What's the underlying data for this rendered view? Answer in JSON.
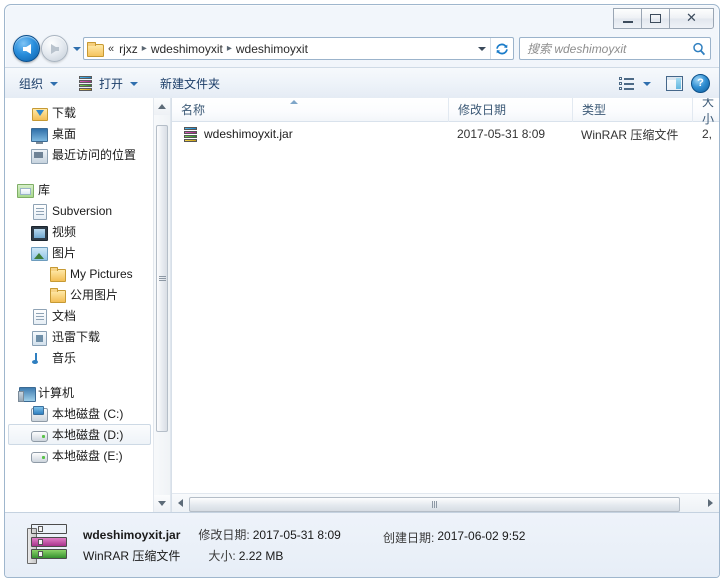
{
  "window": {
    "controls": {
      "minimize": "minimize-button",
      "maximize": "maximize-button",
      "close": "close-button",
      "close_glyph": "✕"
    }
  },
  "address_bar": {
    "overflow_indicator": "«",
    "crumbs": [
      "rjxz",
      "wdeshimoyxit",
      "wdeshimoyxit"
    ],
    "separator": "▸",
    "dropdown_icon": "chevron-down-icon",
    "refresh_icon": "refresh-icon",
    "refresh_glyph": "↻"
  },
  "search": {
    "placeholder": "搜索 wdeshimoyxit",
    "icon": "search-icon"
  },
  "toolbar": {
    "organize_label": "组织",
    "open_label": "打开",
    "new_folder_label": "新建文件夹",
    "view_icon": "list-view-icon",
    "preview_pane_icon": "preview-pane-icon",
    "help_icon": "help-icon",
    "help_glyph": "?"
  },
  "sidebar": {
    "groups": [
      {
        "items": [
          {
            "label": "下载",
            "icon": "downloads-folder-icon",
            "indent": 0,
            "selected": false
          },
          {
            "label": "桌面",
            "icon": "desktop-icon",
            "indent": 0,
            "selected": false
          },
          {
            "label": "最近访问的位置",
            "icon": "recent-places-icon",
            "indent": 0,
            "selected": false
          }
        ]
      },
      {
        "items": [
          {
            "label": "库",
            "icon": "libraries-icon",
            "indent": -1,
            "selected": false
          },
          {
            "label": "Subversion",
            "icon": "subversion-library-icon",
            "indent": 0,
            "selected": false
          },
          {
            "label": "视频",
            "icon": "videos-library-icon",
            "indent": 0,
            "selected": false
          },
          {
            "label": "图片",
            "icon": "pictures-library-icon",
            "indent": 0,
            "selected": false
          },
          {
            "label": "My Pictures",
            "icon": "folder-icon",
            "indent": 1,
            "selected": false
          },
          {
            "label": "公用图片",
            "icon": "folder-icon",
            "indent": 1,
            "selected": false
          },
          {
            "label": "文档",
            "icon": "documents-library-icon",
            "indent": 0,
            "selected": false
          },
          {
            "label": "迅雷下载",
            "icon": "xunlei-download-icon",
            "indent": 0,
            "selected": false
          },
          {
            "label": "音乐",
            "icon": "music-library-icon",
            "indent": 0,
            "selected": false
          }
        ]
      },
      {
        "items": [
          {
            "label": "计算机",
            "icon": "computer-icon",
            "indent": -1,
            "selected": false
          },
          {
            "label": "本地磁盘 (C:)",
            "icon": "system-drive-icon",
            "indent": 0,
            "selected": false
          },
          {
            "label": "本地磁盘 (D:)",
            "icon": "drive-icon",
            "indent": 0,
            "selected": true
          },
          {
            "label": "本地磁盘 (E:)",
            "icon": "drive-icon",
            "indent": 0,
            "selected": false
          }
        ]
      }
    ],
    "scroll_up_icon": "scroll-up-arrow",
    "scroll_down_icon": "scroll-down-arrow"
  },
  "file_list": {
    "columns": [
      {
        "label": "名称",
        "sorted": true
      },
      {
        "label": "修改日期",
        "sorted": false
      },
      {
        "label": "类型",
        "sorted": false
      },
      {
        "label": "大小",
        "sorted": false
      }
    ],
    "rows": [
      {
        "name": "wdeshimoyxit.jar",
        "icon": "winrar-archive-icon",
        "date_modified": "2017-05-31 8:09",
        "type": "WinRAR 压缩文件",
        "size": "2,"
      }
    ],
    "hscroll_left_icon": "scroll-left-arrow",
    "hscroll_right_icon": "scroll-right-arrow"
  },
  "details_pane": {
    "icon": "winrar-archive-icon-large",
    "file_name": "wdeshimoyxit.jar",
    "modified_label": "修改日期:",
    "modified_value": "2017-05-31 8:09",
    "created_label": "创建日期:",
    "created_value": "2017-06-02 9:52",
    "type_value": "WinRAR 压缩文件",
    "size_label": "大小:",
    "size_value": "2.22 MB"
  },
  "colors": {
    "window_border": "#9fb6cd",
    "accent_blue": "#1b7cc9",
    "header_text": "#3d5a77",
    "selection_border": "#cdd9e5"
  }
}
